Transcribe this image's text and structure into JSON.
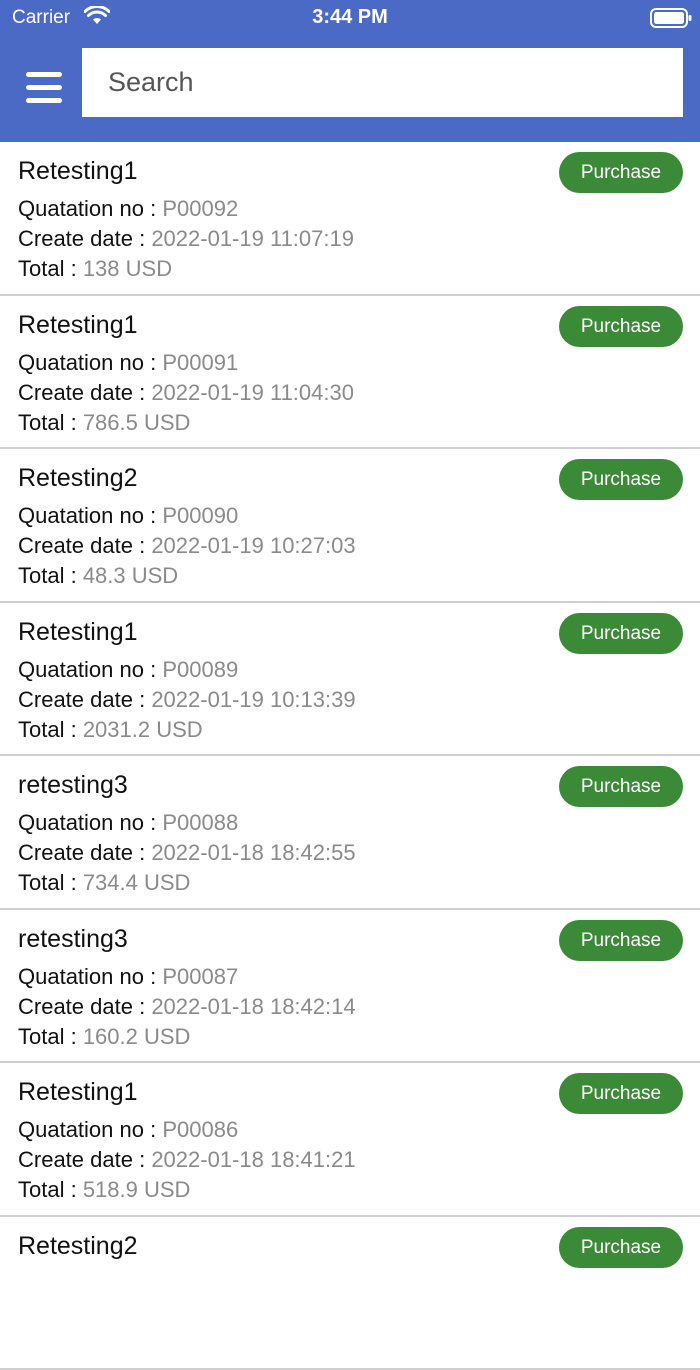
{
  "status_bar": {
    "carrier": "Carrier",
    "time": "3:44 PM"
  },
  "search": {
    "placeholder": "Search"
  },
  "labels": {
    "quotation": "Quatation no : ",
    "create_date": "Create date : ",
    "total": "Total : "
  },
  "quotations": [
    {
      "name": "Retesting1",
      "quotation_no": "P00092",
      "create_date": "2022-01-19 11:07:19",
      "total": "138 USD",
      "action": "Purchase"
    },
    {
      "name": "Retesting1",
      "quotation_no": "P00091",
      "create_date": "2022-01-19 11:04:30",
      "total": "786.5 USD",
      "action": "Purchase"
    },
    {
      "name": "Retesting2",
      "quotation_no": "P00090",
      "create_date": "2022-01-19 10:27:03",
      "total": "48.3 USD",
      "action": "Purchase"
    },
    {
      "name": "Retesting1",
      "quotation_no": "P00089",
      "create_date": "2022-01-19 10:13:39",
      "total": "2031.2 USD",
      "action": "Purchase"
    },
    {
      "name": "retesting3",
      "quotation_no": "P00088",
      "create_date": "2022-01-18 18:42:55",
      "total": "734.4 USD",
      "action": "Purchase"
    },
    {
      "name": "retesting3",
      "quotation_no": "P00087",
      "create_date": "2022-01-18 18:42:14",
      "total": "160.2 USD",
      "action": "Purchase"
    },
    {
      "name": "Retesting1",
      "quotation_no": "P00086",
      "create_date": "2022-01-18 18:41:21",
      "total": "518.9 USD",
      "action": "Purchase"
    },
    {
      "name": "Retesting2",
      "quotation_no": "",
      "create_date": "",
      "total": "",
      "action": "Purchase"
    }
  ],
  "colors": {
    "header": "#4A6AC6",
    "purchase": "#3A8A37",
    "value_text": "#8a8a8a"
  },
  "icons": {
    "menu": "hamburger-menu-icon",
    "wifi": "wifi-icon",
    "battery": "battery-icon"
  }
}
